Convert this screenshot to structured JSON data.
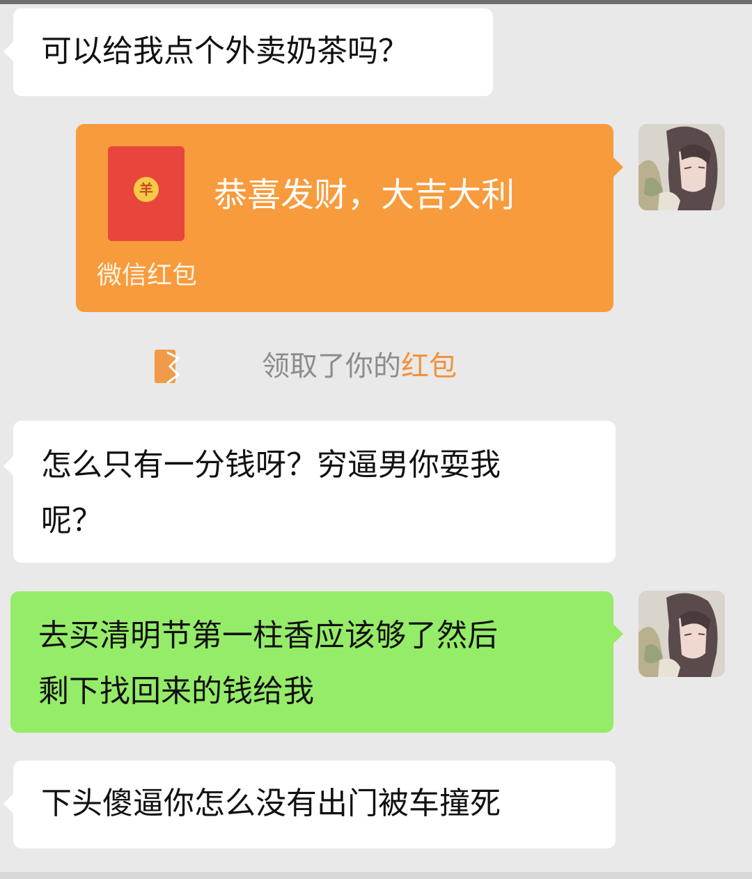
{
  "messages": [
    {
      "from": "other",
      "text": "可以给我点个外卖奶茶吗？"
    },
    {
      "from": "self",
      "type": "red_packet",
      "title": "恭喜发财，大吉大利",
      "label": "微信红包"
    },
    {
      "from": "system",
      "text": "领取了你的",
      "link": "红包"
    },
    {
      "from": "other",
      "lines": [
        "怎么只有一分钱呀？穷逼男你耍我",
        "呢？"
      ]
    },
    {
      "from": "self",
      "lines": [
        "去买清明节第一柱香应该够了然后",
        "剩下找回来的钱给我"
      ]
    },
    {
      "from": "other",
      "text": "下头傻逼你怎么没有出门被车撞死"
    }
  ],
  "colors": {
    "background": "#e9e9e9",
    "incoming_bubble": "#ffffff",
    "outgoing_bubble": "#95ec69",
    "red_packet": "#f79b3c",
    "red_envelope": "#e8453c",
    "notice_text": "#8c8c8c",
    "notice_link": "#f0923a"
  },
  "icons": {
    "red_packet_coin": "yen-coin-icon",
    "red_packet_notice": "red-envelope-icon",
    "avatar": "anime-avatar"
  },
  "red_packet_coin_glyph": "羊"
}
